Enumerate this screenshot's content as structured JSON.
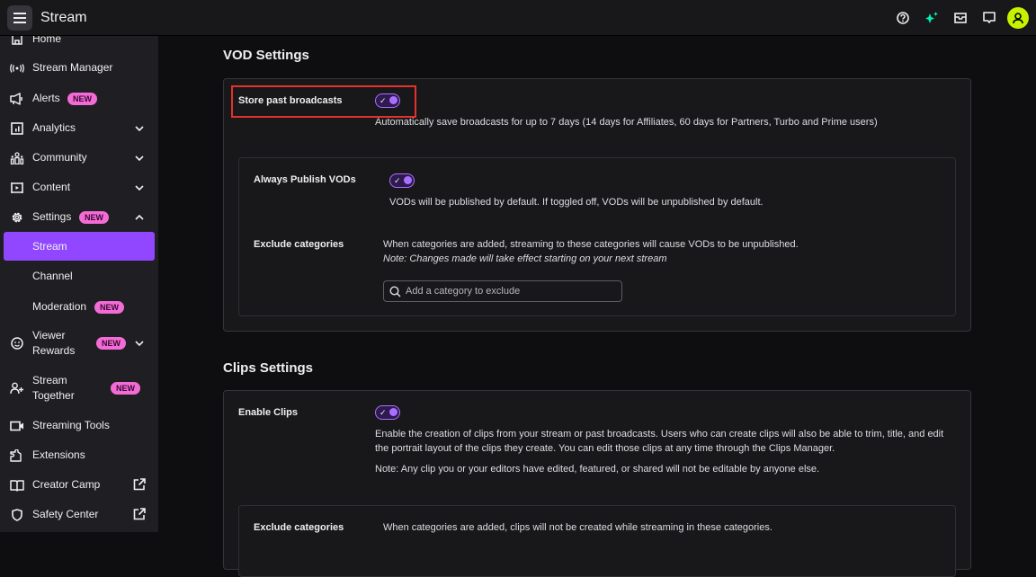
{
  "header": {
    "title": "Stream",
    "icons": [
      "help-icon",
      "sparkle-icon",
      "inbox-icon",
      "whispers-icon",
      "user-avatar-icon"
    ],
    "accent_color": "#9147ff",
    "avatar_color": "#c6f200"
  },
  "sidebar": {
    "items": [
      {
        "label": "Home",
        "icon": "home-icon"
      },
      {
        "label": "Stream Manager",
        "icon": "broadcast-icon"
      },
      {
        "label": "Alerts",
        "icon": "megaphone-icon",
        "badge": "NEW"
      },
      {
        "label": "Analytics",
        "icon": "analytics-icon",
        "expandable": true
      },
      {
        "label": "Community",
        "icon": "community-icon",
        "expandable": true
      },
      {
        "label": "Content",
        "icon": "content-icon",
        "expandable": true
      },
      {
        "label": "Settings",
        "icon": "gear-icon",
        "badge": "NEW",
        "expanded": true
      },
      {
        "label": "Stream",
        "active": true
      },
      {
        "label": "Channel"
      },
      {
        "label": "Moderation",
        "badge": "NEW"
      },
      {
        "label_line1": "Viewer",
        "label_line2": "Rewards",
        "icon": "smiley-icon",
        "badge": "NEW",
        "expandable": true
      },
      {
        "label_line1": "Stream",
        "label_line2": "Together",
        "icon": "add-user-icon",
        "badge": "NEW"
      },
      {
        "label": "Streaming Tools",
        "icon": "camera-icon"
      },
      {
        "label": "Extensions",
        "icon": "puzzle-icon"
      },
      {
        "label": "Creator Camp",
        "icon": "book-icon",
        "external": true
      },
      {
        "label": "Safety Center",
        "icon": "shield-icon",
        "external": true
      }
    ],
    "badge_color": "#f36cd6"
  },
  "vod": {
    "title": "VOD Settings",
    "store_past": {
      "label": "Store past broadcasts",
      "enabled": true,
      "description": "Automatically save broadcasts for up to 7 days (14 days for Affiliates, 60 days for Partners, Turbo and Prime users)"
    },
    "always_publish": {
      "label": "Always Publish VODs",
      "enabled": true,
      "description": "VODs will be published by default. If toggled off, VODs will be unpublished by default."
    },
    "exclude": {
      "label": "Exclude categories",
      "description": "When categories are added, streaming to these categories will cause VODs to be unpublished.",
      "note": "Note: Changes made will take effect starting on your next stream",
      "placeholder": "Add a category to exclude",
      "value": ""
    }
  },
  "clips": {
    "title": "Clips Settings",
    "enable": {
      "label": "Enable Clips",
      "enabled": true,
      "description_line1": "Enable the creation of clips from your stream or past broadcasts. Users who can create clips will also be able to trim, title, and edit",
      "description_line2": "the portrait layout of the clips they create. You can edit those clips at any time through the Clips Manager.",
      "note": "Note: Any clip you or your editors have edited, featured, or shared will not be editable by anyone else."
    },
    "exclude": {
      "label": "Exclude categories",
      "description": "When categories are added, clips will not be created while streaming in these categories."
    }
  },
  "toggle_check": "✓"
}
